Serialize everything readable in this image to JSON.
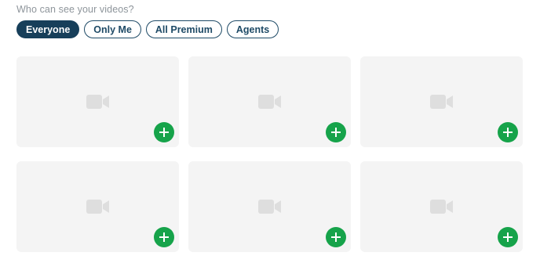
{
  "visibility": {
    "prompt": "Who can see your videos?",
    "options": [
      {
        "label": "Everyone",
        "selected": true
      },
      {
        "label": "Only Me",
        "selected": false
      },
      {
        "label": "All Premium",
        "selected": false
      },
      {
        "label": "Agents",
        "selected": false
      }
    ]
  },
  "video_slots": [
    {
      "icon": "video-camera-icon",
      "action_icon": "plus-icon"
    },
    {
      "icon": "video-camera-icon",
      "action_icon": "plus-icon"
    },
    {
      "icon": "video-camera-icon",
      "action_icon": "plus-icon"
    },
    {
      "icon": "video-camera-icon",
      "action_icon": "plus-icon"
    },
    {
      "icon": "video-camera-icon",
      "action_icon": "plus-icon"
    },
    {
      "icon": "video-camera-icon",
      "action_icon": "plus-icon"
    }
  ],
  "colors": {
    "accent": "#173f5a",
    "add_button": "#16a34a",
    "card_bg": "#f4f4f4",
    "placeholder_icon": "#dedede"
  }
}
